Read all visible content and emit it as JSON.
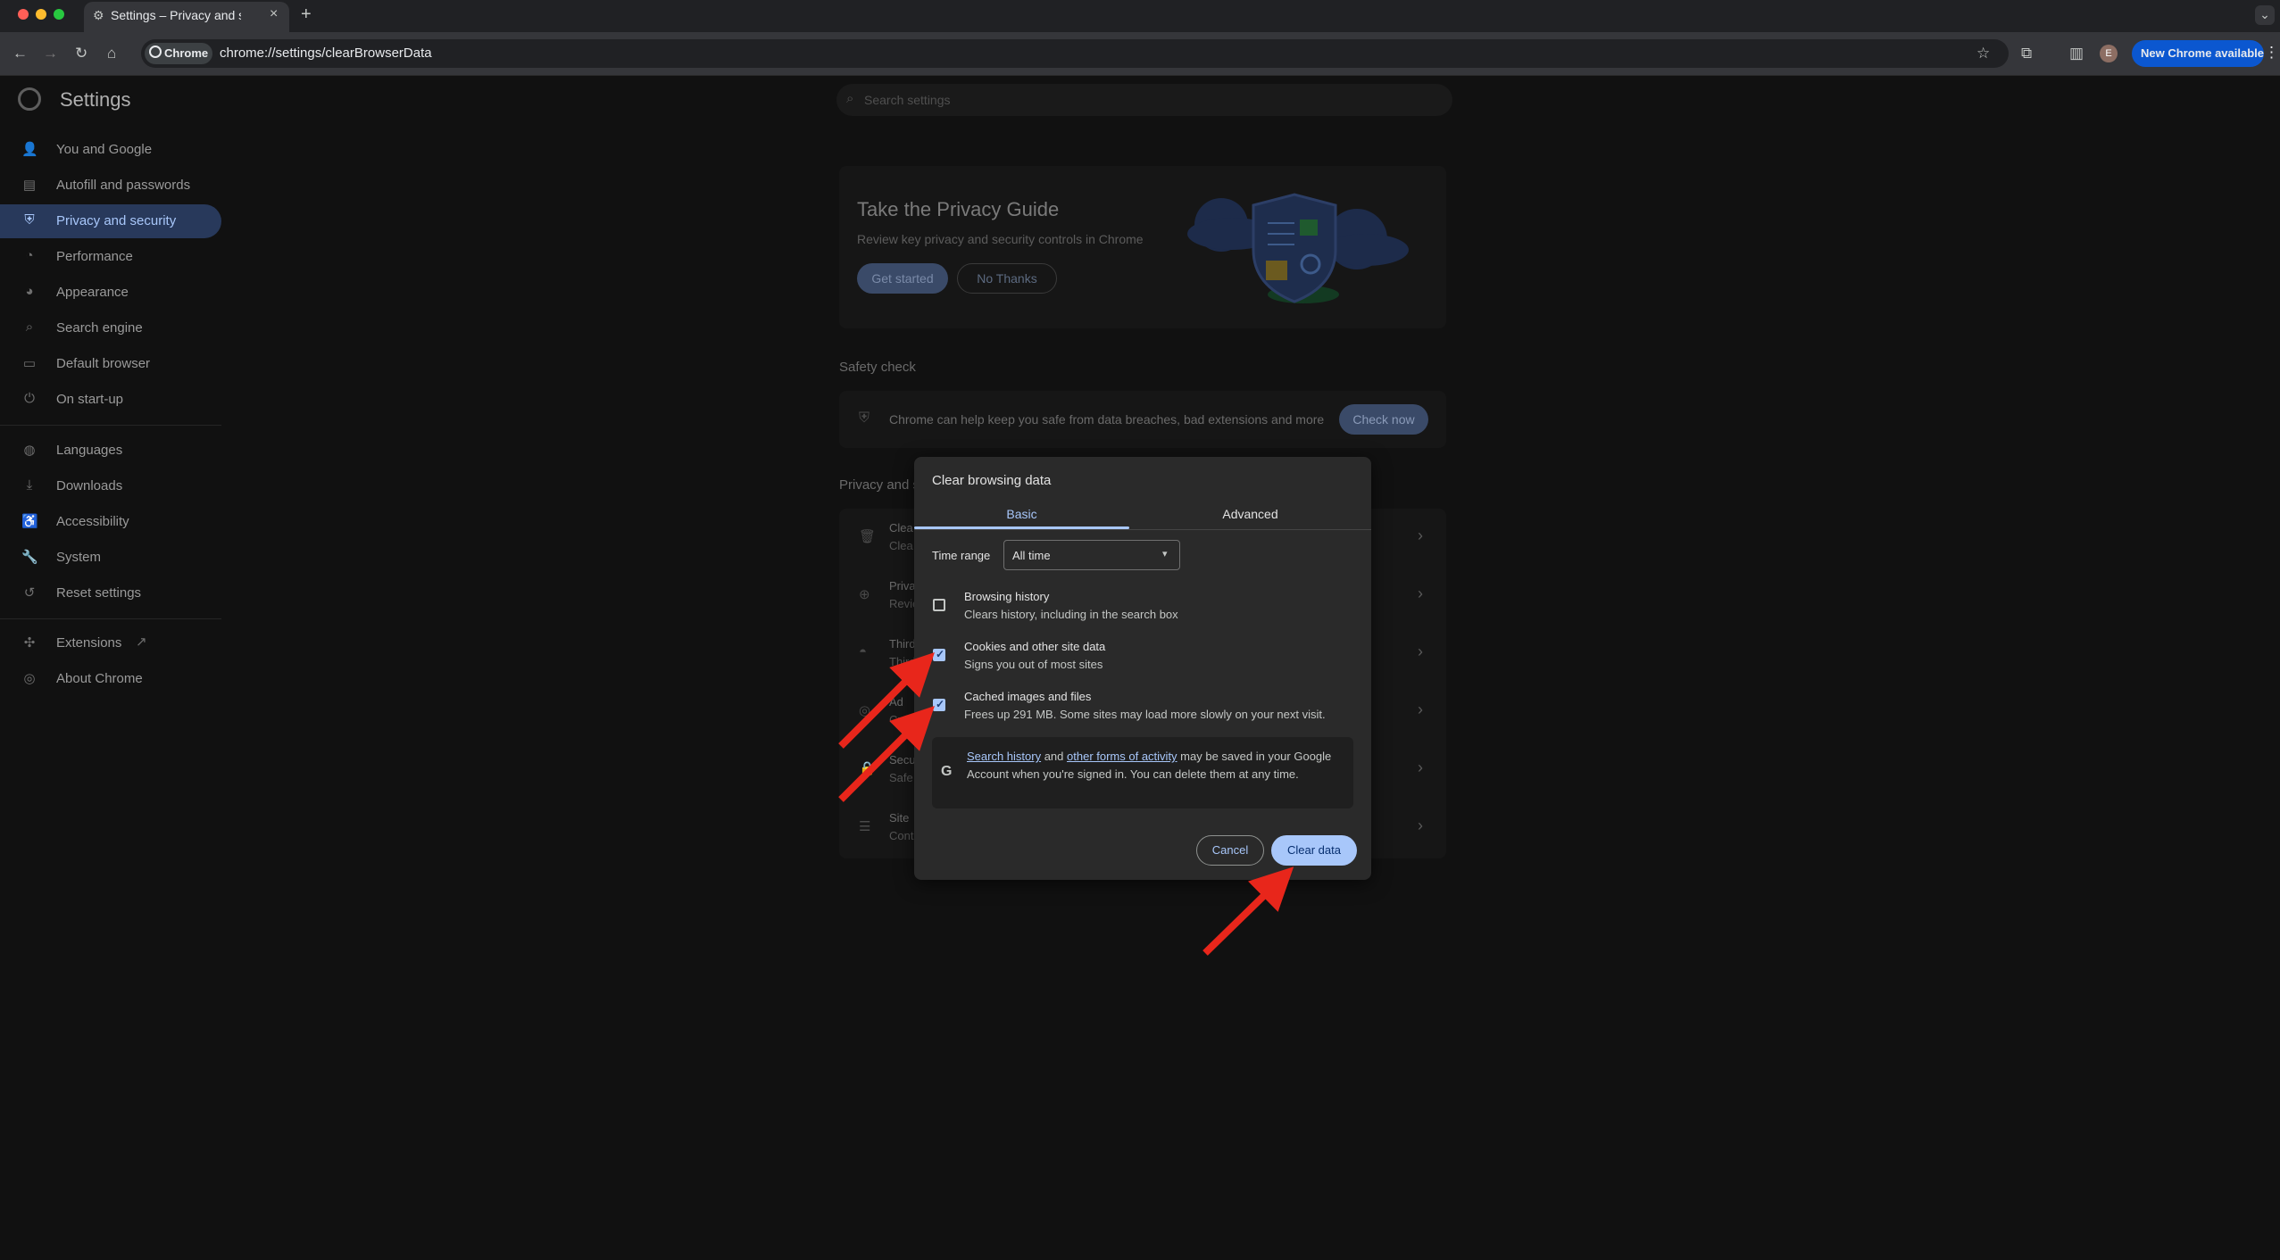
{
  "tab": {
    "title": "Settings – Privacy and security",
    "close": "×",
    "new_tab": "+"
  },
  "toolbar": {
    "back": "←",
    "forward": "→",
    "reload": "↻",
    "home": "⌂",
    "chip_label": "Chrome",
    "url": "chrome://settings/clearBrowserData",
    "bookmark": "☆",
    "extensions": "⧉",
    "sidepanel": "▥",
    "avatar": "E",
    "update_label": "New Chrome available",
    "menu": "⋮",
    "tab_search": "⌄"
  },
  "sidebar": {
    "title": "Settings",
    "items": [
      {
        "label": "You and Google",
        "icon": "person-icon",
        "glyph": "👤"
      },
      {
        "label": "Autofill and passwords",
        "icon": "clipboard-icon",
        "glyph": "▤"
      },
      {
        "label": "Privacy and security",
        "icon": "shield-icon",
        "glyph": "⛨"
      },
      {
        "label": "Performance",
        "icon": "speedometer-icon",
        "glyph": "◔"
      },
      {
        "label": "Appearance",
        "icon": "palette-icon",
        "glyph": "◕"
      },
      {
        "label": "Search engine",
        "icon": "search-icon",
        "glyph": "⌕"
      },
      {
        "label": "Default browser",
        "icon": "browser-icon",
        "glyph": "▭"
      },
      {
        "label": "On start-up",
        "icon": "power-icon",
        "glyph": "⏻"
      },
      {
        "label": "Languages",
        "icon": "globe-icon",
        "glyph": "◍"
      },
      {
        "label": "Downloads",
        "icon": "download-icon",
        "glyph": "⤓"
      },
      {
        "label": "Accessibility",
        "icon": "accessibility-icon",
        "glyph": "♿"
      },
      {
        "label": "System",
        "icon": "wrench-icon",
        "glyph": "🔧"
      },
      {
        "label": "Reset settings",
        "icon": "history-icon",
        "glyph": "↺"
      },
      {
        "label": "Extensions",
        "icon": "puzzle-icon",
        "glyph": "✣",
        "ext_icon": "↗"
      },
      {
        "label": "About Chrome",
        "icon": "chrome-icon",
        "glyph": "◎"
      }
    ]
  },
  "search": {
    "placeholder": "Search settings",
    "icon": "⌕"
  },
  "privacy_guide": {
    "title": "Take the Privacy Guide",
    "subtitle": "Review key privacy and security controls in Chrome",
    "get_started": "Get started",
    "no_thanks": "No Thanks"
  },
  "safety_check": {
    "heading": "Safety check",
    "text": "Chrome can help keep you safe from data breaches, bad extensions and more",
    "button": "Check now"
  },
  "privacy_section": {
    "heading": "Privacy and s",
    "rows": [
      {
        "title": "Clea",
        "sub": "Clea",
        "glyph": "🗑"
      },
      {
        "title": "Priva",
        "sub": "Revie",
        "glyph": "⊕"
      },
      {
        "title": "Third",
        "sub": "Third",
        "glyph": "◓"
      },
      {
        "title": "Ad",
        "sub": "Cust",
        "glyph": "◎"
      },
      {
        "title": "Secu",
        "sub": "Safe",
        "glyph": "🔒"
      },
      {
        "title": "Site",
        "sub": "Cont",
        "glyph": "☰"
      }
    ],
    "chevron": "›"
  },
  "dialog": {
    "title": "Clear browsing data",
    "tabs": {
      "basic": "Basic",
      "advanced": "Advanced"
    },
    "time_range_label": "Time range",
    "time_range_value": "All time",
    "dropdown_arrow": "▾",
    "items": [
      {
        "label": "Browsing history",
        "sub": "Clears history, including in the search box",
        "checked": false
      },
      {
        "label": "Cookies and other site data",
        "sub": "Signs you out of most sites",
        "checked": true
      },
      {
        "label": "Cached images and files",
        "sub": "Frees up 291 MB. Some sites may load more slowly on your next visit.",
        "checked": true
      }
    ],
    "checkmark": "✓",
    "info": {
      "logo": "G",
      "link1": "Search history",
      "and": " and ",
      "link2": "other forms of activity",
      "rest": " may be saved in your Google Account when you're signed in. You can delete them at any time."
    },
    "cancel": "Cancel",
    "clear": "Clear data"
  },
  "colors": {
    "annotation_arrow": "#e8261b",
    "accent": "#a8c7fa",
    "update_button": "#0b57d0"
  }
}
